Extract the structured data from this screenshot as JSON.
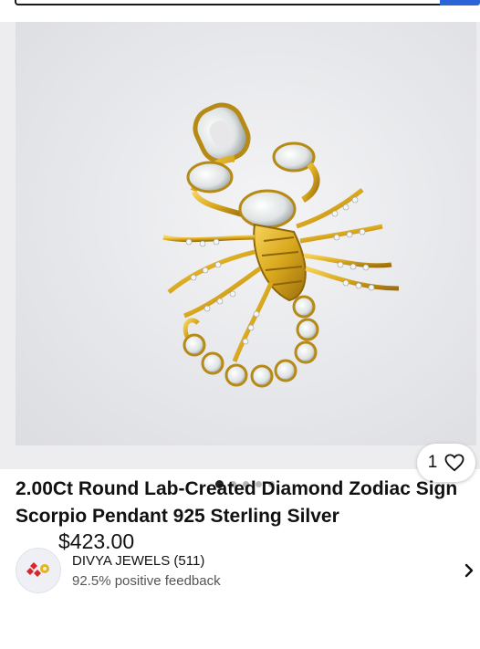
{
  "listing": {
    "title": "2.00Ct Round Lab-Created Diamond Zodiac Sign Scorpio Pendant 925 Sterling Silver",
    "price": "$423.00",
    "watch_count": "1",
    "image_count": 5,
    "current_image": 1
  },
  "seller": {
    "name": "DIVYA JEWELS (511)",
    "feedback": "92.5% positive feedback"
  },
  "colors": {
    "accent": "#2a64d6",
    "gold": "#d9a81e",
    "diamond": "#eef0f0"
  },
  "icons": {
    "watch": "heart-icon",
    "seller_detail": "chevron-right-icon"
  }
}
